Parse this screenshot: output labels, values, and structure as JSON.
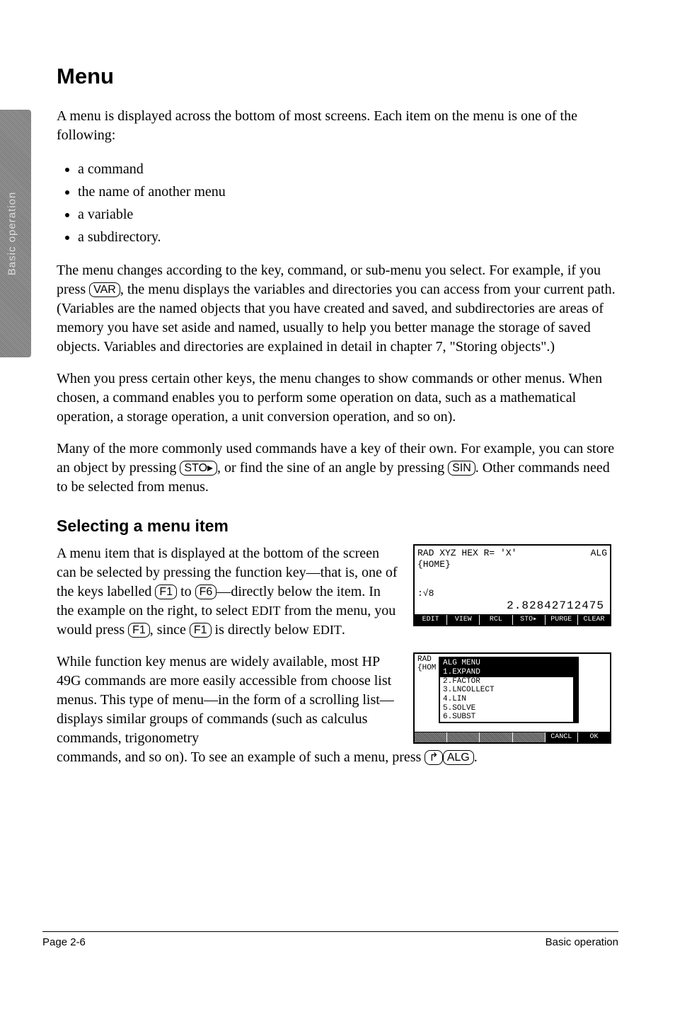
{
  "side_tab": "Basic operation",
  "h1": "Menu",
  "p1": "A menu is displayed across the bottom of most screens. Each item on the menu is one of the following:",
  "bullets": [
    "a command",
    "the name of another menu",
    "a variable",
    "a subdirectory."
  ],
  "p2a": "The menu changes according to the key, command, or sub-menu you select. For example, if you press ",
  "key_var": "VAR",
  "p2b": ", the menu displays the variables and directories you can access from your current path. (Variables are the named objects that you have created and saved, and subdirectories are areas of memory you have set aside and named, usually to help you better manage the storage of saved objects. Variables and directories are explained in detail in chapter 7, \"Storing objects\".)",
  "p3": "When you press certain other keys, the menu changes to show commands or other menus. When chosen, a command enables you to perform some operation on data, such as a mathematical operation, a storage operation, a unit conversion operation, and so on).",
  "p4a": "Many of the more commonly used commands have a key of their own. For example, you can store an object by pressing ",
  "key_sto": "STO▸",
  "p4b": ", or find the sine of an angle by pressing ",
  "key_sin": "SIN",
  "p4c": ". Other commands need to be selected from menus.",
  "h2": "Selecting a menu item",
  "p5a": "A menu item that is displayed at the bottom of the screen can be selected by pressing the function key—that is, one of the keys labelled ",
  "key_f1": "F1",
  "p5b": " to ",
  "key_f6": "F6",
  "p5c": "—directly below the item. In the example on the right, to select ",
  "sc_edit": "EDIT",
  "p5d": " from the menu, you would press ",
  "p5e": ", since ",
  "p5f": " is directly below ",
  "p5g": ".",
  "p6a": "While function key menus are widely available, most HP 49G commands are more easily accessible from choose list menus. This type of menu—in the form of a scrolling list—displays similar groups of commands (such as calculus commands, trigonometry commands, and so on). To see an example of such a menu, press ",
  "key_right": "↱",
  "key_alg": "ALG",
  "p6b": ".",
  "fig1": {
    "status_left": "RAD XYZ HEX R= 'X'",
    "status_right": "ALG",
    "path": "{HOME}",
    "expr": ":√8",
    "result": "2.82842712475",
    "softkeys": [
      "EDIT",
      "VIEW",
      "RCL",
      "STO▸",
      "PURGE",
      "CLEAR"
    ]
  },
  "fig2": {
    "hdr": "RAD\n{HOM",
    "popup_title": "ALG MENU",
    "items": [
      "1.EXPAND",
      "2.FACTOR",
      "3.LNCOLLECT",
      "4.LIN",
      "5.SOLVE",
      "6.SUBST"
    ],
    "selected_index": 0,
    "softkeys": [
      "",
      "",
      "",
      "",
      "CANCL",
      "OK"
    ]
  },
  "footer_left": "Page 2-6",
  "footer_right": "Basic operation"
}
